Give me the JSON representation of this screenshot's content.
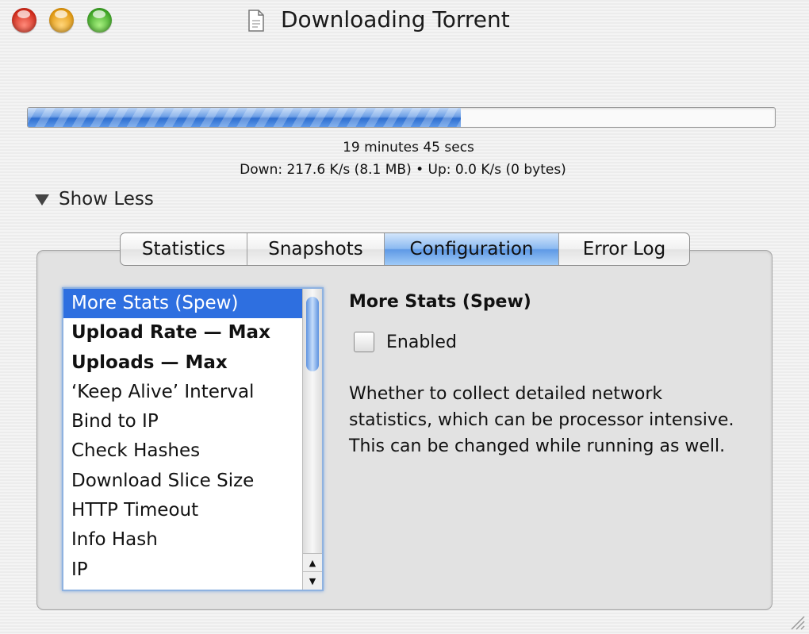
{
  "window": {
    "title": "Downloading Torrent",
    "controls": [
      "close",
      "minimize",
      "zoom"
    ]
  },
  "progress": {
    "fraction": 0.58,
    "time_remaining": "19 minutes 45 secs",
    "rates": "Down: 217.6 K/s (8.1 MB) • Up: 0.0 K/s (0 bytes)"
  },
  "disclosure": {
    "label": "Show Less",
    "icon": "triangle-down"
  },
  "tabs": [
    {
      "label": "Statistics"
    },
    {
      "label": "Snapshots"
    },
    {
      "label": "Configuration",
      "active": true
    },
    {
      "label": "Error Log"
    }
  ],
  "config_list": {
    "items": [
      {
        "label": "More Stats (Spew)",
        "selected": true,
        "bold": false
      },
      {
        "label": "Upload Rate — Max",
        "bold": true
      },
      {
        "label": "Uploads — Max",
        "bold": true
      },
      {
        "label": "‘Keep Alive’ Interval"
      },
      {
        "label": "Bind to IP"
      },
      {
        "label": "Check Hashes"
      },
      {
        "label": "Download Slice Size"
      },
      {
        "label": "HTTP Timeout"
      },
      {
        "label": "Info Hash"
      },
      {
        "label": "IP"
      }
    ]
  },
  "detail": {
    "title": "More Stats (Spew)",
    "checkbox_label": "Enabled",
    "checked": false,
    "description": "Whether to collect detailed network statistics, which can be processor intensive. This can be changed while running as well."
  },
  "colors": {
    "selection": "#2e6fe0",
    "progress": "#2f6fd0",
    "active_tab": "#8cbaf1"
  }
}
